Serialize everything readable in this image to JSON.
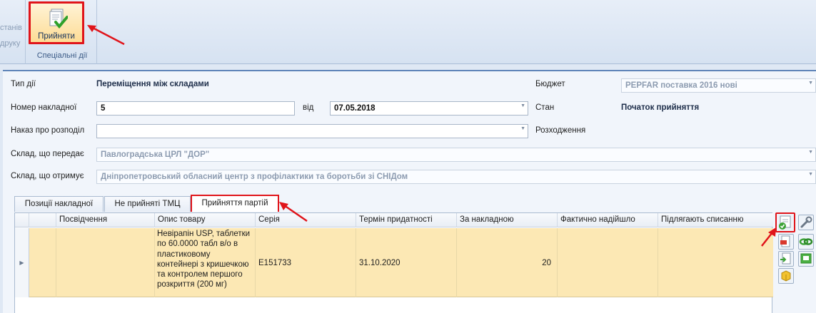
{
  "ribbon": {
    "left_items": [
      "станів",
      "друку"
    ],
    "accept_button": "Прийняти",
    "group_label": "Спеціальні дії"
  },
  "form": {
    "action_type_label": "Тип дії",
    "action_type_value": "Переміщення між складами",
    "invoice_number_label": "Номер накладної",
    "invoice_number_value": "5",
    "date_from_label": "від",
    "date_value": "07.05.2018",
    "distribution_order_label": "Наказ про розподіл",
    "distribution_order_value": "",
    "sender_warehouse_label": "Склад, що передає",
    "sender_warehouse_value": "Павлоградська ЦРЛ \"ДОР\"",
    "receiver_warehouse_label": "Склад, що отримує",
    "receiver_warehouse_value": "Дніпропетровський обласний центр з профілактики та боротьби зі СНІДом",
    "budget_label": "Бюджет",
    "budget_value": "PEPFAR поставка 2016 нові",
    "state_label": "Стан",
    "state_value": "Початок прийняття",
    "discrepancy_label": "Розходження"
  },
  "tabs": [
    {
      "label": "Позиції накладної"
    },
    {
      "label": "Не прийняті ТМЦ"
    },
    {
      "label": "Прийняття партій"
    }
  ],
  "grid": {
    "columns": [
      "Посвідчення",
      "Опис товару",
      "Серія",
      "Термін придатності",
      "За накладною",
      "Фактично надійшло",
      "Підлягають списанню"
    ],
    "rows": [
      {
        "certificate": "",
        "description": "Невірапін USP, таблетки\nпо 60.0000 табл в/о в\nпластиковому\nконтейнері з кришечкою\nта контролем першого\nрозкриття (200 мг)",
        "series": "E151733",
        "expiry": "31.10.2020",
        "by_invoice": "20",
        "actually_received": "",
        "to_write_off": ""
      }
    ]
  },
  "side_tools": [
    "accept-batch-icon",
    "wrench-icon",
    "document-red-icon",
    "link-green-icon",
    "import-green-icon",
    "table-green-icon",
    "cube-yellow-icon"
  ]
}
